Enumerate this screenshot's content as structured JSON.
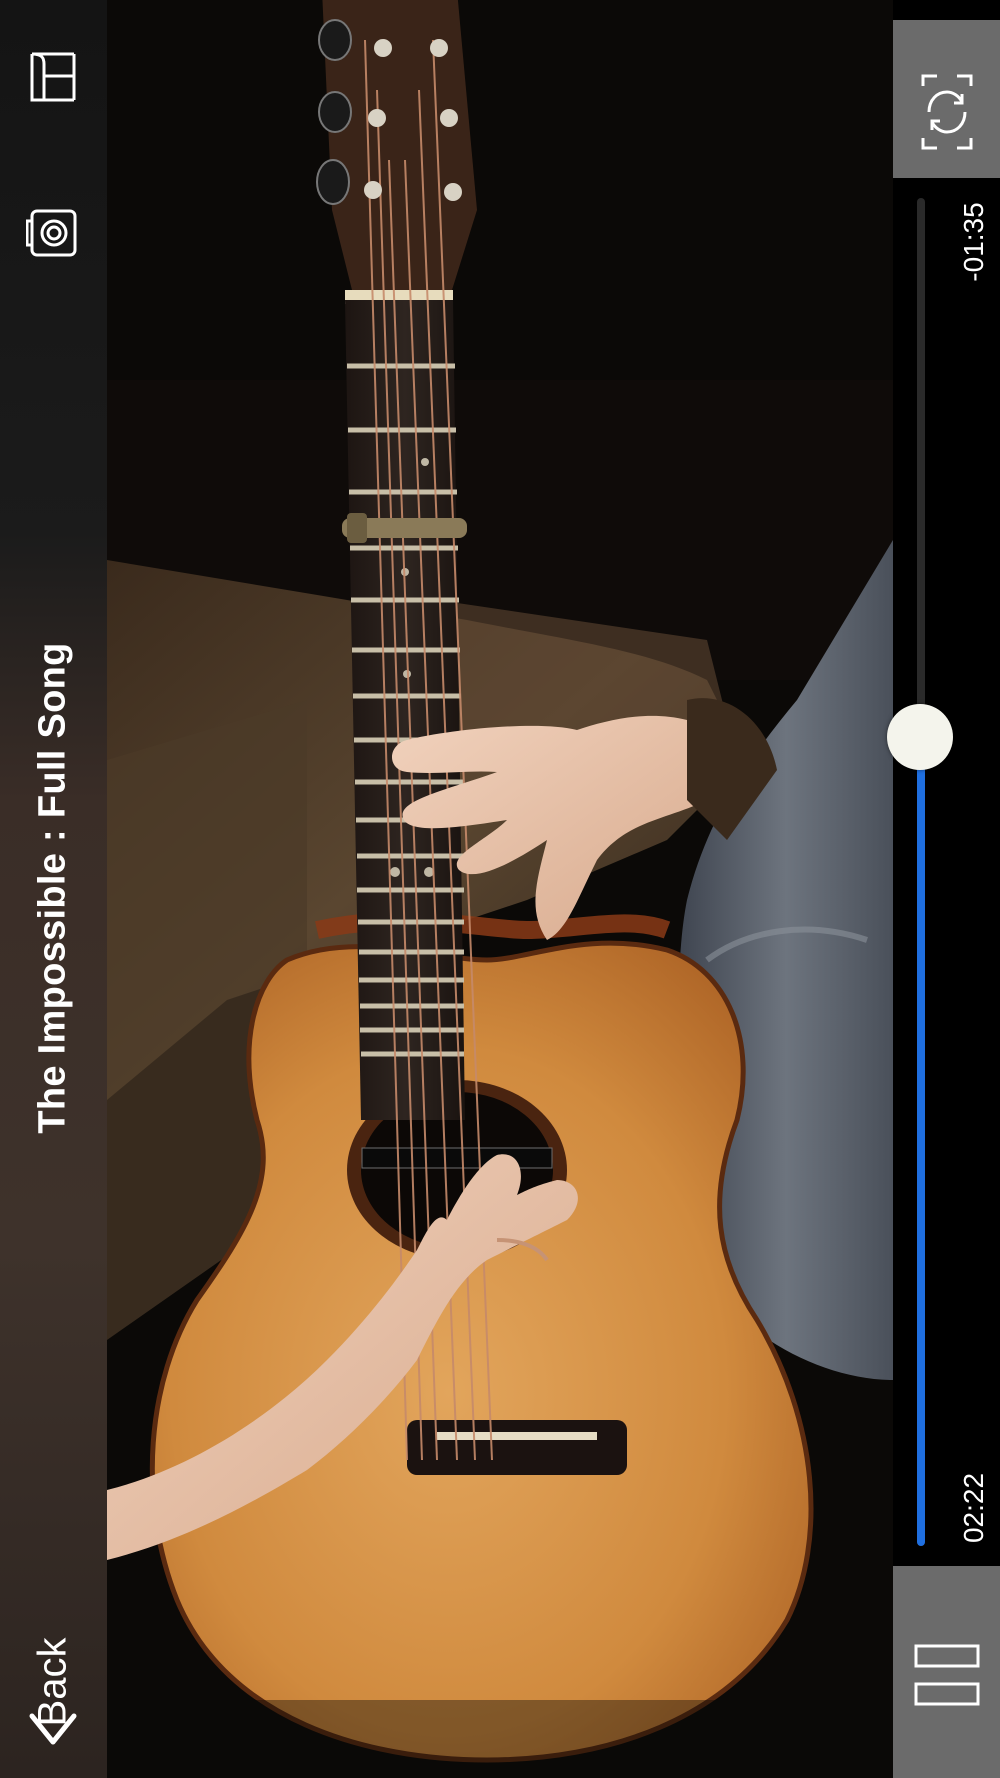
{
  "video": {
    "title": "The Impossible : Full Song",
    "back_label": "Back",
    "time_elapsed": "02:22",
    "time_remaining": "-01:35",
    "progress_fraction": 0.6
  },
  "controls": {
    "left_top_icon": "book-icon",
    "left_second_icon": "camera-icon",
    "right_top_icon": "rotate-screen-icon",
    "right_bottom_icon": "pause-icon",
    "back_icon": "chevron-left-icon"
  },
  "colors": {
    "progress": "#1f6fe0",
    "thumb": "#f4f4ec",
    "control_bg": "#6b6b6b"
  }
}
